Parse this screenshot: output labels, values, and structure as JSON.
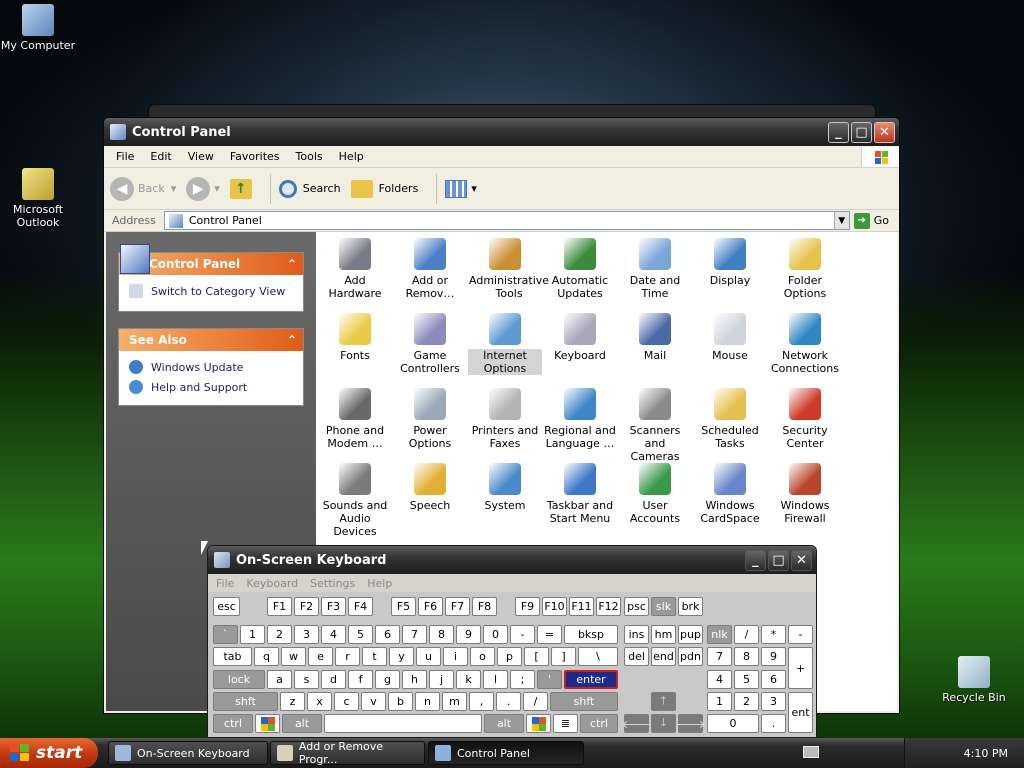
{
  "desktop": {
    "icons": [
      {
        "label": "My Computer"
      },
      {
        "label": "Microsoft Outlook"
      },
      {
        "label": "Recycle Bin"
      }
    ]
  },
  "control_panel": {
    "title": "Control Panel",
    "menu": [
      "File",
      "Edit",
      "View",
      "Favorites",
      "Tools",
      "Help"
    ],
    "toolbar": {
      "back": "Back",
      "search": "Search",
      "folders": "Folders"
    },
    "address": {
      "label": "Address",
      "value": "Control Panel",
      "go": "Go"
    },
    "left": {
      "panel1": {
        "title": "Control Panel",
        "items": [
          "Switch to Category View"
        ]
      },
      "panel2": {
        "title": "See Also",
        "items": [
          "Windows Update",
          "Help and Support"
        ]
      }
    },
    "icons": [
      {
        "label": "Add Hardware",
        "icon": "hardware-icon",
        "c": "#7a7a88"
      },
      {
        "label": "Add or Remov…",
        "icon": "add-remove-icon",
        "c": "#4c7fc8"
      },
      {
        "label": "Administrative Tools",
        "icon": "admin-tools-icon",
        "c": "#c98f33"
      },
      {
        "label": "Automatic Updates",
        "icon": "windows-logo-icon",
        "c": "#3a8a3a"
      },
      {
        "label": "Date and Time",
        "icon": "clock-icon",
        "c": "#7aa6d8"
      },
      {
        "label": "Display",
        "icon": "display-icon",
        "c": "#3f7fc2"
      },
      {
        "label": "Folder Options",
        "icon": "folder-icon",
        "c": "#e6c34a"
      },
      {
        "label": "Fonts",
        "icon": "fonts-folder-icon",
        "c": "#e8cc44"
      },
      {
        "label": "Game Controllers",
        "icon": "gamepad-icon",
        "c": "#8c8cbc"
      },
      {
        "label": "Internet Options",
        "icon": "globe-settings-icon",
        "c": "#5a9ad0"
      },
      {
        "label": "Keyboard",
        "icon": "keyboard-icon",
        "c": "#a8a8b8"
      },
      {
        "label": "Mail",
        "icon": "mail-icon",
        "c": "#4a6aa8"
      },
      {
        "label": "Mouse",
        "icon": "mouse-icon",
        "c": "#cfd3dc"
      },
      {
        "label": "Network Connections",
        "icon": "network-globe-icon",
        "c": "#2f88c4"
      },
      {
        "label": "Phone and Modem …",
        "icon": "phone-icon",
        "c": "#6a6a6a"
      },
      {
        "label": "Power Options",
        "icon": "power-icon",
        "c": "#9aa8b8"
      },
      {
        "label": "Printers and Faxes",
        "icon": "printer-icon",
        "c": "#b4b4b4"
      },
      {
        "label": "Regional and Language …",
        "icon": "globe-icon",
        "c": "#3f86c8"
      },
      {
        "label": "Scanners and Cameras",
        "icon": "camera-icon",
        "c": "#8a8a8a"
      },
      {
        "label": "Scheduled Tasks",
        "icon": "scheduled-folder-icon",
        "c": "#e4c050"
      },
      {
        "label": "Security Center",
        "icon": "shield-icon",
        "c": "#cf3a28"
      },
      {
        "label": "Sounds and Audio Devices",
        "icon": "speaker-icon",
        "c": "#7a7a7a"
      },
      {
        "label": "Speech",
        "icon": "speech-icon",
        "c": "#e0b030"
      },
      {
        "label": "System",
        "icon": "computer-icon",
        "c": "#4a8ac8"
      },
      {
        "label": "Taskbar and Start Menu",
        "icon": "taskbar-icon",
        "c": "#3c78c8"
      },
      {
        "label": "User Accounts",
        "icon": "users-icon",
        "c": "#3a9a4a"
      },
      {
        "label": "Windows CardSpace",
        "icon": "cardspace-icon",
        "c": "#6a86c8"
      },
      {
        "label": "Windows Firewall",
        "icon": "firewall-icon",
        "c": "#b8442a"
      }
    ],
    "selected": "Internet Options"
  },
  "keyboard": {
    "title": "On-Screen Keyboard",
    "menu": [
      "File",
      "Keyboard",
      "Settings",
      "Help"
    ],
    "keys": [
      {
        "id": "esc",
        "l": "esc"
      },
      {
        "id": "f1",
        "l": "F1"
      },
      {
        "id": "f2",
        "l": "F2"
      },
      {
        "id": "f3",
        "l": "F3"
      },
      {
        "id": "f4",
        "l": "F4"
      },
      {
        "id": "f5",
        "l": "F5"
      },
      {
        "id": "f6",
        "l": "F6"
      },
      {
        "id": "f7",
        "l": "F7"
      },
      {
        "id": "f8",
        "l": "F8"
      },
      {
        "id": "f9",
        "l": "F9"
      },
      {
        "id": "f10",
        "l": "F10"
      },
      {
        "id": "f11",
        "l": "F11"
      },
      {
        "id": "f12",
        "l": "F12"
      },
      {
        "id": "psc",
        "l": "psc"
      },
      {
        "id": "slk",
        "l": "slk"
      },
      {
        "id": "brk",
        "l": "brk"
      },
      {
        "id": "tick",
        "l": "`"
      },
      {
        "id": "k1",
        "l": "1"
      },
      {
        "id": "k2",
        "l": "2"
      },
      {
        "id": "k3",
        "l": "3"
      },
      {
        "id": "k4",
        "l": "4"
      },
      {
        "id": "k5",
        "l": "5"
      },
      {
        "id": "k6",
        "l": "6"
      },
      {
        "id": "k7",
        "l": "7"
      },
      {
        "id": "k8",
        "l": "8"
      },
      {
        "id": "k9",
        "l": "9"
      },
      {
        "id": "k0",
        "l": "0"
      },
      {
        "id": "minus",
        "l": "-"
      },
      {
        "id": "eq",
        "l": "="
      },
      {
        "id": "bksp",
        "l": "bksp"
      },
      {
        "id": "ins",
        "l": "ins"
      },
      {
        "id": "hm",
        "l": "hm"
      },
      {
        "id": "pup",
        "l": "pup"
      },
      {
        "id": "nlk",
        "l": "nlk"
      },
      {
        "id": "ndiv",
        "l": "/"
      },
      {
        "id": "nmul",
        "l": "*"
      },
      {
        "id": "nsub",
        "l": "-"
      },
      {
        "id": "tab",
        "l": "tab"
      },
      {
        "id": "q",
        "l": "q"
      },
      {
        "id": "w",
        "l": "w"
      },
      {
        "id": "e",
        "l": "e"
      },
      {
        "id": "r",
        "l": "r"
      },
      {
        "id": "t",
        "l": "t"
      },
      {
        "id": "y",
        "l": "y"
      },
      {
        "id": "u",
        "l": "u"
      },
      {
        "id": "i",
        "l": "i"
      },
      {
        "id": "o",
        "l": "o"
      },
      {
        "id": "p",
        "l": "p"
      },
      {
        "id": "lbr",
        "l": "["
      },
      {
        "id": "rbr",
        "l": "]"
      },
      {
        "id": "bsl",
        "l": "\\"
      },
      {
        "id": "del",
        "l": "del"
      },
      {
        "id": "end",
        "l": "end"
      },
      {
        "id": "pdn",
        "l": "pdn"
      },
      {
        "id": "n7",
        "l": "7"
      },
      {
        "id": "n8",
        "l": "8"
      },
      {
        "id": "n9",
        "l": "9"
      },
      {
        "id": "nadd",
        "l": "+"
      },
      {
        "id": "lock",
        "l": "lock"
      },
      {
        "id": "a",
        "l": "a"
      },
      {
        "id": "s",
        "l": "s"
      },
      {
        "id": "d",
        "l": "d"
      },
      {
        "id": "f",
        "l": "f"
      },
      {
        "id": "g",
        "l": "g"
      },
      {
        "id": "h",
        "l": "h"
      },
      {
        "id": "j",
        "l": "j"
      },
      {
        "id": "k",
        "l": "k"
      },
      {
        "id": "l",
        "l": "l"
      },
      {
        "id": "semi",
        "l": ";"
      },
      {
        "id": "quote",
        "l": "'"
      },
      {
        "id": "enter",
        "l": "enter"
      },
      {
        "id": "n4",
        "l": "4"
      },
      {
        "id": "n5",
        "l": "5"
      },
      {
        "id": "n6",
        "l": "6"
      },
      {
        "id": "lshft",
        "l": "shft"
      },
      {
        "id": "z",
        "l": "z"
      },
      {
        "id": "x",
        "l": "x"
      },
      {
        "id": "c",
        "l": "c"
      },
      {
        "id": "v",
        "l": "v"
      },
      {
        "id": "b",
        "l": "b"
      },
      {
        "id": "n",
        "l": "n"
      },
      {
        "id": "m",
        "l": "m"
      },
      {
        "id": "comma",
        "l": ","
      },
      {
        "id": "dot",
        "l": "."
      },
      {
        "id": "slash",
        "l": "/"
      },
      {
        "id": "rshft",
        "l": "shft"
      },
      {
        "id": "up",
        "l": "🡑"
      },
      {
        "id": "n1",
        "l": "1"
      },
      {
        "id": "n2",
        "l": "2"
      },
      {
        "id": "n3",
        "l": "3"
      },
      {
        "id": "lctrl",
        "l": "ctrl"
      },
      {
        "id": "lwin",
        "l": ""
      },
      {
        "id": "lalt",
        "l": "alt"
      },
      {
        "id": "space",
        "l": ""
      },
      {
        "id": "ralt",
        "l": "alt"
      },
      {
        "id": "rwin",
        "l": ""
      },
      {
        "id": "app",
        "l": "≣"
      },
      {
        "id": "rctrl",
        "l": "ctrl"
      },
      {
        "id": "left",
        "l": "🡐"
      },
      {
        "id": "down",
        "l": "🡓"
      },
      {
        "id": "right",
        "l": "🡒"
      },
      {
        "id": "n0",
        "l": "0"
      },
      {
        "id": "ndot",
        "l": "."
      },
      {
        "id": "nent",
        "l": "ent"
      }
    ]
  },
  "taskbar": {
    "start": "start",
    "tasks": [
      {
        "label": "On-Screen Keyboard"
      },
      {
        "label": "Add or Remove Progr..."
      },
      {
        "label": "Control Panel"
      }
    ],
    "clock": "4:10 PM"
  }
}
